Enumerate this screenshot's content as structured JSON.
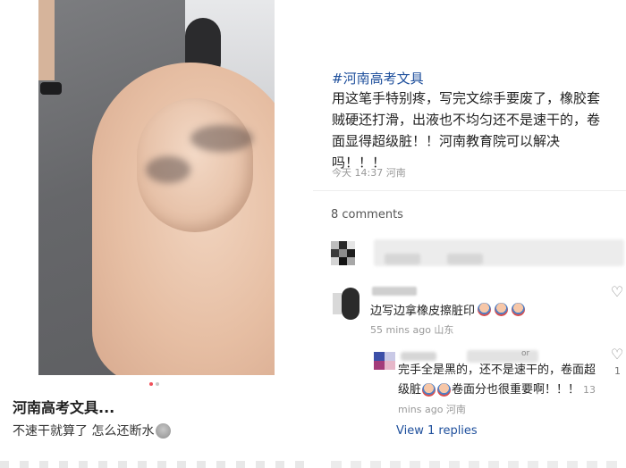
{
  "left_post": {
    "title": "河南高考文具...",
    "body": "不速干就算了 怎么还断水",
    "carousel": {
      "count": 2,
      "active": 1
    }
  },
  "right_post": {
    "hashtag": "#河南高考文具",
    "content": "用这笔手特别疼，写完文综手要废了，橡胶套贼硬还打滑，出液也不均匀还不是速干的，卷面显得超级脏！！河南教育院可以解决吗！！！",
    "meta": "今天 14:37 河南",
    "comments_count": "8 comments"
  },
  "comments": [
    {
      "text": "边写边拿橡皮擦脏印",
      "emoji_count": 3,
      "meta": "55 mins ago 山东",
      "reply": {
        "text_part1": "完手全是黑的，还不是速干的，卷面超级脏",
        "text_part2": "卷面分也很重要啊！！！",
        "meta": "13 mins ago 河南",
        "likes": "1",
        "author_suffix": "or"
      },
      "view_replies": "View 1 replies"
    }
  ],
  "colors": {
    "link_blue": "#1e4f9c",
    "meta_gray": "#999999",
    "dot_active": "#f0505a"
  }
}
